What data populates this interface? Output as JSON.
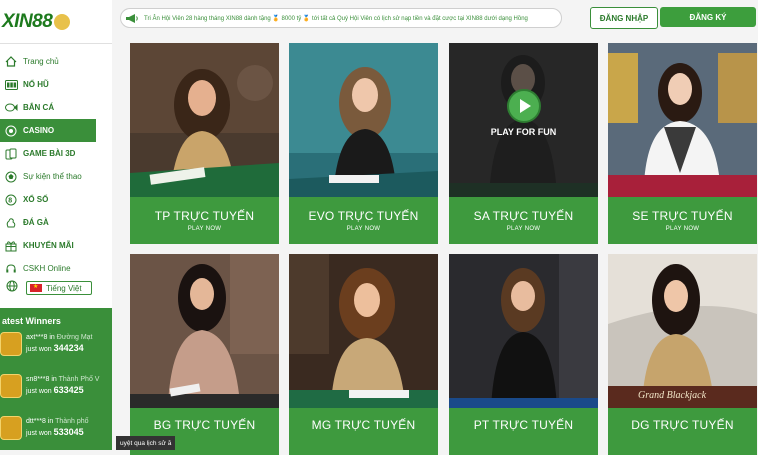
{
  "logo": {
    "text": "XIN88"
  },
  "sidebar": {
    "items": [
      {
        "label": "Trang chủ",
        "icon": "home-icon"
      },
      {
        "label": "NỔ HŨ",
        "icon": "slot-icon"
      },
      {
        "label": "BẮN CÁ",
        "icon": "fish-icon"
      },
      {
        "label": "CASINO",
        "icon": "casino-icon",
        "active": true
      },
      {
        "label": "GAME BÀI 3D",
        "icon": "cards-icon"
      },
      {
        "label": "Sự kiện thể thao",
        "icon": "sports-icon"
      },
      {
        "label": "XỔ SỐ",
        "icon": "lottery-icon"
      },
      {
        "label": "ĐÁ GÀ",
        "icon": "rooster-icon"
      },
      {
        "label": "KHUYẾN MÃI",
        "icon": "gift-icon"
      },
      {
        "label": "CSKH Online",
        "icon": "support-icon"
      }
    ],
    "language": "Tiếng Việt"
  },
  "winners": {
    "title": "atest Winners",
    "list": [
      {
        "name": "axt***8",
        "in": "in",
        "location": "Đường Mạt",
        "won_label": "just won",
        "amount": "344234"
      },
      {
        "name": "sn8***8",
        "in": "in",
        "location": "Thành Phố V",
        "won_label": "just won",
        "amount": "633425"
      },
      {
        "name": "dtt***8",
        "in": "in",
        "location": "Thành phố",
        "won_label": "just won",
        "amount": "533045"
      }
    ]
  },
  "header": {
    "marquee": "Tri Ân Hội Viên 28 hàng tháng XIN88 dành tặng 🏅 8000 tỷ 🏅 tới tất cả Quý Hội Viên có lịch sử nạp tiền và đặt cược tại XIN88 dưới dạng Hồng",
    "login": "ĐĂNG NHẬP",
    "register": "ĐĂNG KÝ"
  },
  "games": [
    {
      "title": "TP TRỰC TUYẾN",
      "sub": "PLAY NOW"
    },
    {
      "title": "EVO TRỰC TUYẾN",
      "sub": "PLAY NOW"
    },
    {
      "title": "SA TRỰC TUYẾN",
      "sub": "PLAY NOW",
      "overlay": "PLAY FOR FUN"
    },
    {
      "title": "SE TRỰC TUYẾN",
      "sub": "PLAY NOW"
    },
    {
      "title": "BG TRỰC TUYẾN",
      "sub": ""
    },
    {
      "title": "MG TRỰC TUYẾN",
      "sub": ""
    },
    {
      "title": "PT TRỰC TUYẾN",
      "sub": ""
    },
    {
      "title": "DG TRỰC TUYẾN",
      "sub": "",
      "table_text": "Grand Blackjack"
    }
  ],
  "tooltip": "uyệt qua lịch sử ă",
  "colors": {
    "brand_green": "#3e9a3e",
    "dark_green": "#2b7a2b"
  }
}
